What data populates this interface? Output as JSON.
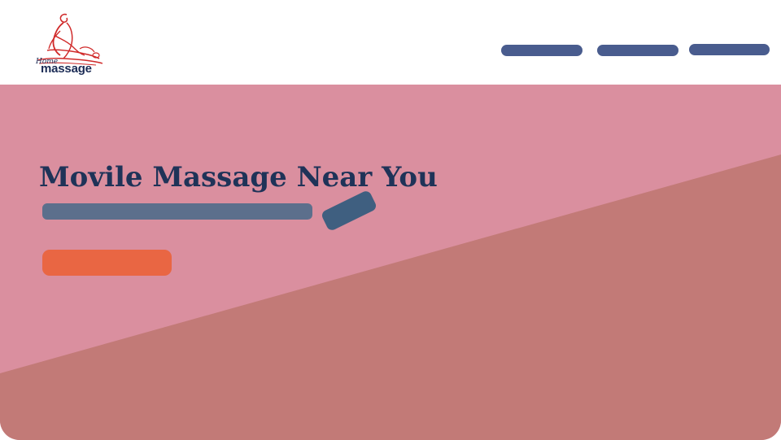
{
  "header": {
    "logo": {
      "icon": "massage-figure-icon",
      "home_text": "Home",
      "massage_text": "massage"
    },
    "nav": {
      "items": [
        {
          "label": ""
        },
        {
          "label": ""
        },
        {
          "label": ""
        }
      ],
      "color": "#495c8e"
    }
  },
  "hero": {
    "title": "Movile Massage Near You",
    "background_color": "#da8f9f",
    "diagonal_shape_color": "#c27a77",
    "cta": {
      "label": "",
      "color": "#e96643"
    },
    "colors": {
      "title": "#1f3358",
      "subline": "#5c6f8c",
      "tag": "#3f5f80"
    }
  }
}
